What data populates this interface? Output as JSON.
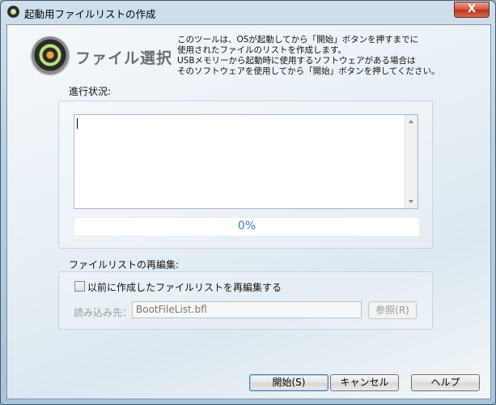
{
  "window": {
    "title": "起動用ファイルリストの作成",
    "close_label": "X"
  },
  "header": {
    "title": "ファイル選択",
    "description": [
      "このツールは、OSが起動してから「開始」ボタンを押すまでに",
      "使用されたファイルのリストを作成します。",
      "USBメモリーから起動時に使用するソフトウェアがある場合は",
      "そのソフトウェアを使用してから「開始」ボタンを押してください。"
    ]
  },
  "progress_section": {
    "label": "進行状況:",
    "log_text": "",
    "progress_value": 0,
    "progress_text": "0%"
  },
  "reedit_section": {
    "label": "ファイルリストの再編集:",
    "checkbox_label": "以前に作成したファイルリストを再編集する",
    "checkbox_checked": false,
    "read_label": "読み込み先：",
    "path_value": "BootFileList.bfl",
    "browse_label": "参照(R)"
  },
  "buttons": {
    "start": "開始(S)",
    "cancel": "キャンセル",
    "help": "ヘルプ"
  }
}
